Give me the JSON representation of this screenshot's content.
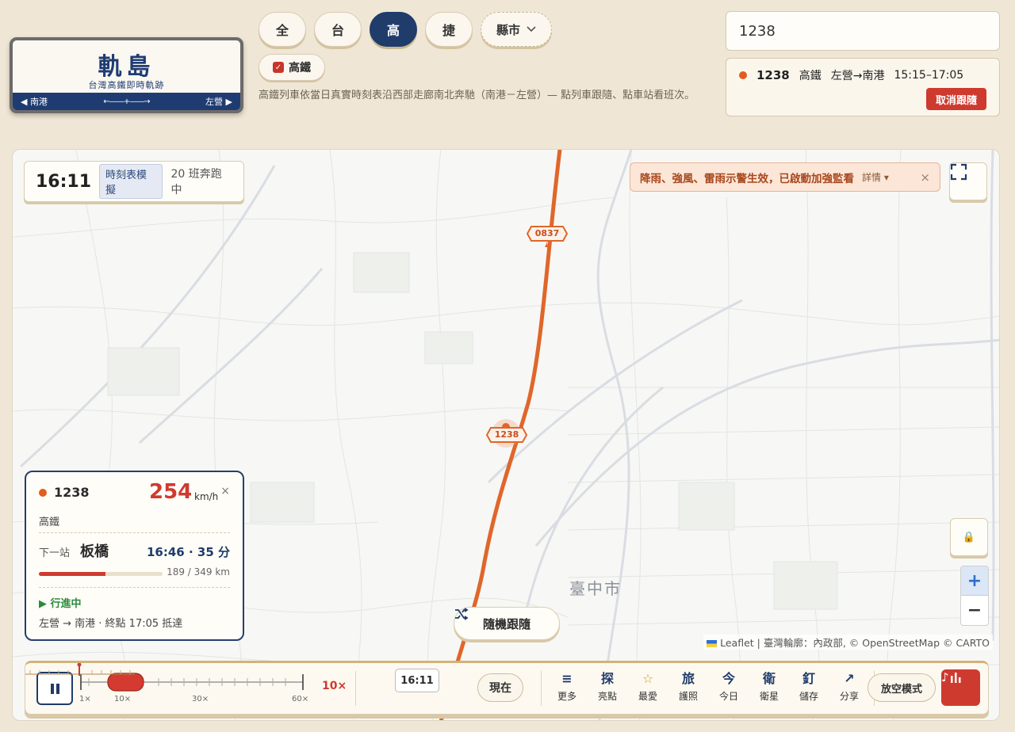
{
  "logo": {
    "title": "軌島",
    "subtitle": "台灣高鐵即時軌跡",
    "left_station": "南港",
    "right_station": "左營",
    "left_arrow": "◀",
    "right_arrow": "▶",
    "mid": "←——+——→"
  },
  "filters": {
    "tabs": [
      "全",
      "台",
      "高",
      "捷"
    ],
    "active": "高",
    "county": "縣市",
    "hsr_label": "高鐵",
    "hsr_checked": true
  },
  "description": "高鐵列車依當日真實時刻表沿西部走廊南北奔馳（南港－左營）— 點列車跟隨、點車站看班次。",
  "search": {
    "value": "1238"
  },
  "following": {
    "train": "1238",
    "type": "高鐵",
    "route": "左營→南港",
    "time": "15:15–17:05",
    "cancel": "取消跟隨"
  },
  "map": {
    "clock": "16:11",
    "mode": "時刻表模擬",
    "running": "20 班奔跑中",
    "alert": "降雨、強風、雷雨示警生效，已啟動加強監看",
    "alert_more": "詳情 ▾",
    "alert_close": "×",
    "city": "臺中市",
    "train_a": "0837",
    "train_b": "1238",
    "zoom_in": "+",
    "zoom_out": "−",
    "lock": "🔒",
    "attribution": "Leaflet | 臺灣輪廓：內政部, © OpenStreetMap © CARTO",
    "random_follow": "隨機跟隨"
  },
  "card": {
    "train": "1238",
    "speed": "254",
    "speed_unit": "km/h",
    "close": "×",
    "type": "高鐵",
    "next_label": "下一站",
    "next_station": "板橋",
    "next_time": "16:46 · 35 分",
    "progress": 0.54,
    "distance": "189 / 349 km",
    "status": "▶ 行進中",
    "route": "左營 → 南港 · 終點 17:05 抵達"
  },
  "controls": {
    "speed_ticks": [
      "1×",
      "10×",
      "30×",
      "60×"
    ],
    "speed_value": "10×",
    "time": "16:11",
    "now": "現在",
    "tools": [
      {
        "icon": "≡",
        "label": "更多"
      },
      {
        "icon": "探",
        "label": "亮點"
      },
      {
        "icon": "☆",
        "label": "最愛"
      },
      {
        "icon": "旅",
        "label": "護照"
      },
      {
        "icon": "今",
        "label": "今日"
      },
      {
        "icon": "衛",
        "label": "衛星"
      },
      {
        "icon": "釘",
        "label": "儲存"
      },
      {
        "icon": "↗",
        "label": "分享"
      }
    ],
    "air_mode": "放空模式"
  },
  "colors": {
    "accent": "#cf3a2f",
    "navy": "#1f3c6b",
    "rail": "#e0662a",
    "background": "#efe6d5"
  }
}
